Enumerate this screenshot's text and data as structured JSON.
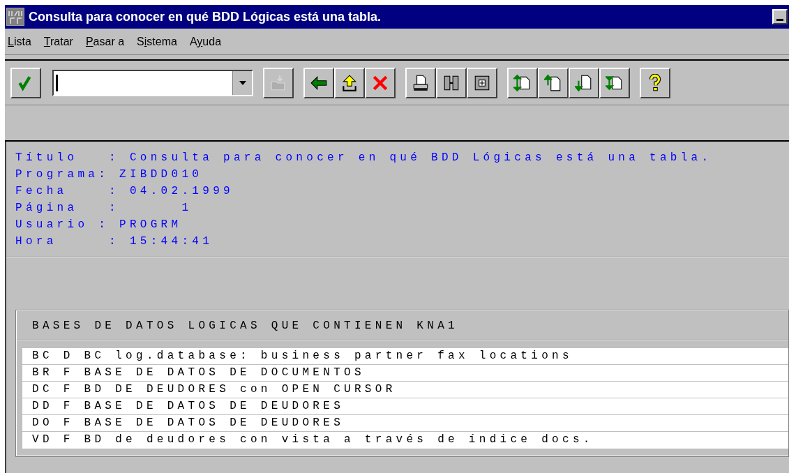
{
  "window": {
    "title": "Consulta para conocer en qué BDD Lógicas está una tabla."
  },
  "menu": [
    {
      "label": "Lista"
    },
    {
      "label": "Tratar"
    },
    {
      "label": "Pasar a"
    },
    {
      "label": "Sistema"
    },
    {
      "label": "Ayuda"
    }
  ],
  "toolbar": {
    "buttons": [
      {
        "kind": "enter",
        "disabled": false
      },
      {
        "kind": "command",
        "disabled": false
      },
      {
        "kind": "save",
        "disabled": true
      },
      {
        "kind": "back",
        "disabled": false
      },
      {
        "kind": "exit",
        "disabled": false
      },
      {
        "kind": "cancel",
        "disabled": false
      },
      {
        "kind": "print",
        "disabled": false
      },
      {
        "kind": "find",
        "disabled": false
      },
      {
        "kind": "find_next",
        "disabled": false
      },
      {
        "kind": "first_page",
        "disabled": false
      },
      {
        "kind": "previous_page",
        "disabled": false
      },
      {
        "kind": "next_page",
        "disabled": false
      },
      {
        "kind": "last_page",
        "disabled": false
      },
      {
        "kind": "help",
        "disabled": false
      }
    ]
  },
  "report_header": [
    "Título   : Consulta para conocer en qué BDD Lógicas está una tabla.",
    "Programa: ZIBDD010",
    "Fecha    : 04.02.1999",
    "Página   :      1",
    "Usuario : PROGRM",
    "Hora     : 15:44:41"
  ],
  "list": {
    "title": "BASES DE DATOS LOGICAS QUE CONTIENEN KNA1",
    "rows": [
      "BC D BC log.database: business partner fax locations",
      "BR F BASE DE DATOS DE DOCUMENTOS",
      "DC F BD DE DEUDORES con OPEN CURSOR",
      "DD F BASE DE DATOS DE DEUDORES",
      "DO F BASE DE DATOS DE DEUDORES",
      "VD F BD de deudores con vista a través de índice docs."
    ]
  }
}
